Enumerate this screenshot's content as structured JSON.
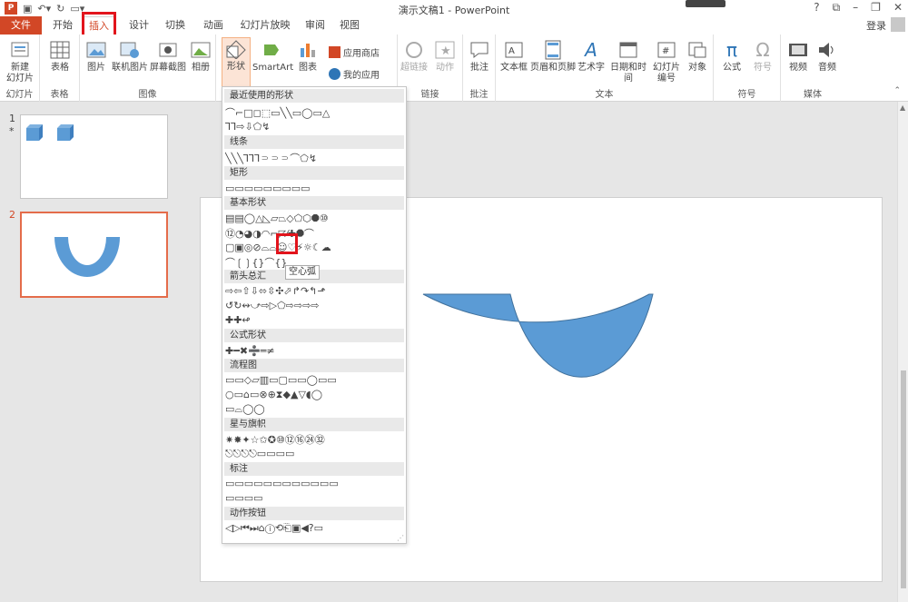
{
  "title": {
    "doc": "演示文稿1 - PowerPoint"
  },
  "titlebar": {
    "help": "?",
    "ribbon_opt": "⧉",
    "minimize": "–",
    "restore": "❐",
    "close": "✕"
  },
  "tabs": [
    "文件",
    "开始",
    "插入",
    "设计",
    "切换",
    "动画",
    "幻灯片放映",
    "审阅",
    "视图"
  ],
  "login": "登录",
  "ribbon": {
    "new_slide": "新建\n幻灯片",
    "g_slides": "幻灯片",
    "table": "表格",
    "g_table": "表格",
    "picture": "图片",
    "online_picture": "联机图片",
    "screenshot": "屏幕截图",
    "album": "相册",
    "g_images": "图像",
    "shapes": "形状",
    "smartart": "SmartArt",
    "chart": "图表",
    "app_store": "应用商店",
    "my_apps": "我的应用",
    "hyperlink": "超链接",
    "action": "动作",
    "g_links": "链接",
    "comment": "批注",
    "g_comments": "批注",
    "textbox": "文本框",
    "header_footer": "页眉和页脚",
    "wordart": "艺术字",
    "datetime": "日期和时间",
    "slide_number": "幻灯片\n编号",
    "object": "对象",
    "g_text": "文本",
    "equation": "公式",
    "symbol": "符号",
    "g_symbols": "符号",
    "video": "视频",
    "audio": "音频",
    "g_media": "媒体"
  },
  "slides": {
    "n1": "1",
    "star": "*",
    "n2": "2"
  },
  "shapes_menu": {
    "sections": [
      "最近使用的形状",
      "线条",
      "矩形",
      "基本形状",
      "箭头总汇",
      "公式形状",
      "流程图",
      "星与旗帜",
      "标注",
      "动作按钮"
    ],
    "rows": [
      "⌒⌐□◻⬚▭╲╲▭◯▭△",
      "⅂⅂⇨⇩⬠↯",
      "╲╲╲⅂⅂⅂⸧⸧⸧⌒⬠↯",
      "▭▭▭▭▭▭▭▭▭",
      "▤▤◯△◺▱⏢◇⬠⬡⯃⑩",
      "⑫◔◕◑◠⌐◸⁄✚⯃⌒",
      "▢▣◎⊘⌓⌓☺♡⚡☼☾☁",
      "⌒❲❳{}⌒{}",
      "⇨⇦⇧⇩⬄⇳✣⬀↱↷↰⬏",
      "↺↻↭⤻⇨▷⬠⇨⇨⇨⇨",
      "✚✚↫",
      "✚━✖➗═≠",
      "▭▭◇▱▥▭▢▭▭◯▭▭",
      "○▭⌂▭⊗⊕⧗◆▲▽◖◯",
      "▭⌓◯◯",
      "✷✸✦☆✩✪⑩⑫⑯㉔㉜",
      "⎋⎋⎋⎋▭▭▭▭",
      "▭▭▭▭▭▭▭▭▭▭▭▭",
      "▭▭▭▭",
      "◁▷⏮⏭⌂ⓘ⟲⎗▣◀?▭"
    ],
    "tooltip": "空心弧"
  },
  "colors": {
    "accent": "#d24726",
    "shape_fill": "#5b9bd5",
    "highlight": "#e2141c"
  }
}
